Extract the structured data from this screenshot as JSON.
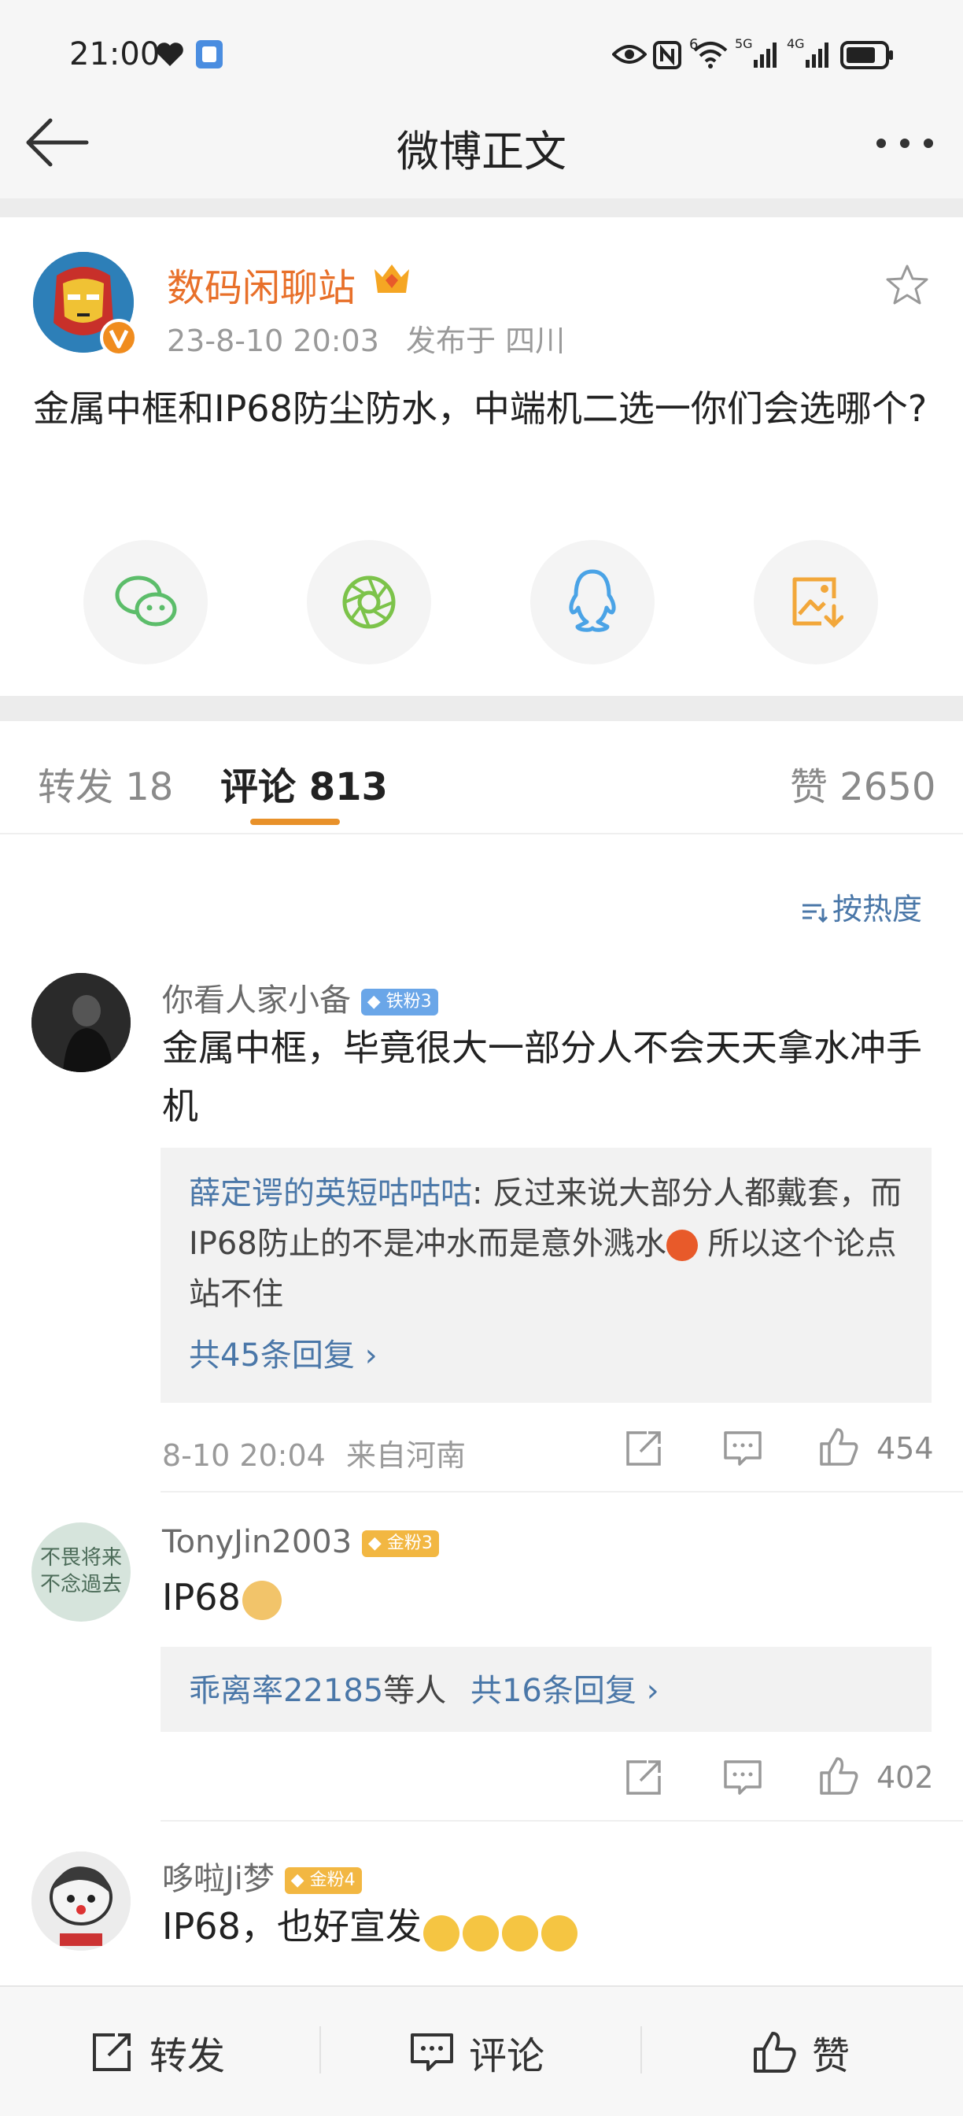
{
  "status_bar": {
    "time": "21:00",
    "icons": [
      "heart-icon",
      "app-notification-icon",
      "eye-icon",
      "nfc-icon",
      "wifi-icon",
      "5g-signal-icon",
      "4g-signal-icon",
      "battery-icon"
    ],
    "wifi_label": "6",
    "signal1_label": "5G",
    "signal2_label": "4G"
  },
  "nav": {
    "title": "微博正文",
    "back_icon": "back-arrow-icon",
    "more_icon": "more-dots-icon"
  },
  "post": {
    "author": "数码闲聊站",
    "time": "23-8-10 20:03",
    "location": "发布于 四川",
    "text": "金属中框和IP68防尘防水，中端机二选一你们会选哪个?",
    "share_targets": [
      "wechat-icon",
      "moments-icon",
      "qq-icon",
      "save-image-icon"
    ]
  },
  "tabs": {
    "repost": "转发 18",
    "comments": "评论 813",
    "likes": "赞 2650"
  },
  "sort_label": "按热度",
  "comments": [
    {
      "user": "你看人家小备",
      "badge": "铁粉3",
      "text": "金属中框，毕竟很大一部分人不会天天拿水冲手机",
      "reply_user": "薛定谔的英短咕咕咕",
      "reply_text": ": 反过来说大部分人都戴套，而IP68防止的不是冲水而是意外溅水",
      "reply_text_end": " 所以这个论点站不住",
      "reply_more": "共45条回复",
      "time": "8-10 20:04",
      "source": "来自河南",
      "likes": "454"
    },
    {
      "user": "TonyJin2003",
      "badge": "金粉3",
      "text": "IP68",
      "avatar_text": "不畏将来不念過去",
      "reply_users": "乖离率22185",
      "reply_users_suffix": "等人",
      "reply_more": "共16条回复",
      "likes": "402"
    },
    {
      "user": "哆啦Ji梦",
      "badge": "金粉4",
      "text": "IP68，也好宣发"
    }
  ],
  "bottom_bar": {
    "repost": "转发",
    "comment": "评论",
    "like": "赞"
  },
  "colors": {
    "author": "#e8702a",
    "link": "#4a77a8",
    "tab_underline": "#e8912a"
  }
}
